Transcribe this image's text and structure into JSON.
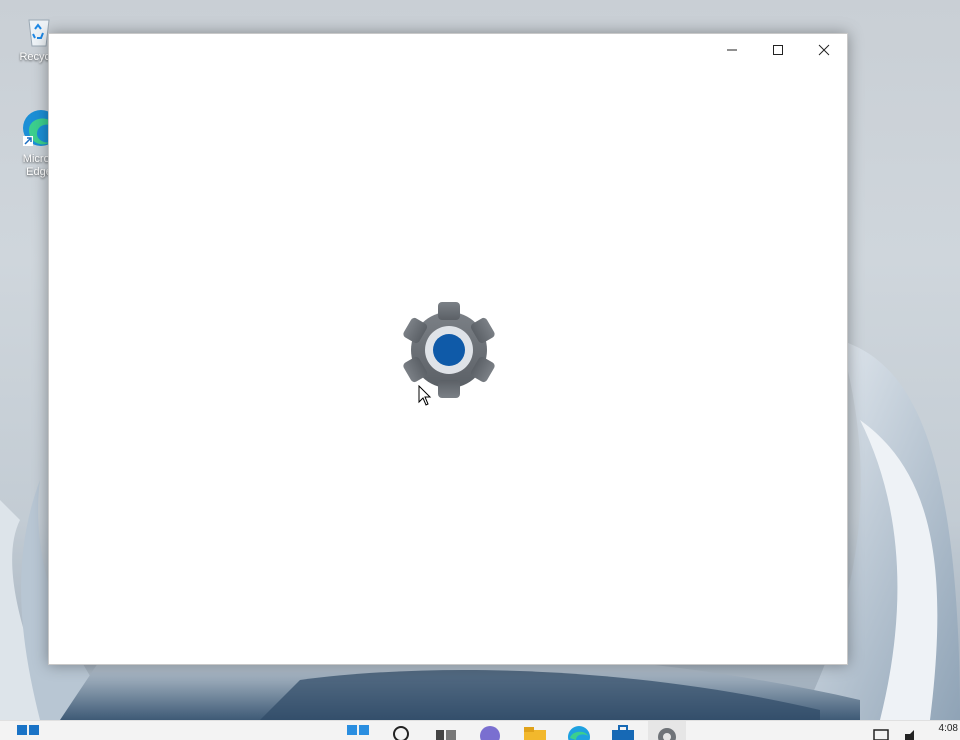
{
  "desktop": {
    "icons": [
      {
        "label": "Recycle",
        "icon": "recycle-bin-icon"
      },
      {
        "label": "Micros",
        "label2": "Edge",
        "icon": "edge-icon"
      }
    ]
  },
  "window": {
    "splash_icon": "settings-gear-icon",
    "controls": {
      "minimize": "minimize-icon",
      "maximize": "maximize-icon",
      "close": "close-icon"
    }
  },
  "taskbar": {
    "icons": [
      "start-icon",
      "search-icon",
      "task-view-icon",
      "chat-icon",
      "file-explorer-icon",
      "edge-icon",
      "store-icon",
      "settings-icon"
    ],
    "tray_time": "4:08"
  },
  "colors": {
    "gear_gray": "#6f7378",
    "gear_blue": "#0f5aa8",
    "window_bg": "#ffffff"
  }
}
